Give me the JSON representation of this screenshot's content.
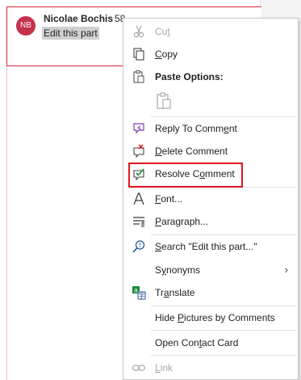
{
  "comment": {
    "avatar_initials": "NB",
    "author": "Nicolae Bochis",
    "time": "58",
    "text": "Edit this part"
  },
  "menu": {
    "cut": {
      "pre": "Cu",
      "u": "t",
      "post": ""
    },
    "copy": {
      "pre": "",
      "u": "C",
      "post": "opy"
    },
    "paste_options": "Paste Options:",
    "reply": {
      "pre": "Reply To Comm",
      "u": "e",
      "post": "nt"
    },
    "delete": {
      "pre": "",
      "u": "D",
      "post": "elete Comment"
    },
    "resolve": {
      "pre": "Resolve C",
      "u": "o",
      "post": "mment"
    },
    "font": {
      "pre": "",
      "u": "F",
      "post": "ont..."
    },
    "paragraph": {
      "pre": "",
      "u": "P",
      "post": "aragraph..."
    },
    "search": {
      "pre": "",
      "u": "S",
      "post": "earch \"Edit this part...\""
    },
    "synonyms": {
      "pre": "S",
      "u": "y",
      "post": "nonyms"
    },
    "translate": {
      "pre": "Tr",
      "u": "a",
      "post": "nslate"
    },
    "hide_pictures": {
      "pre": "Hide ",
      "u": "P",
      "post": "ictures by Comments"
    },
    "open_contact": {
      "pre": "Open Con",
      "u": "t",
      "post": "act Card"
    },
    "link": {
      "pre": "",
      "u": "L",
      "post": "ink"
    },
    "submenu_chevron": "›"
  },
  "icons": {
    "cut": "scissors-icon",
    "copy": "copy-icon",
    "paste": "clipboard-icon",
    "reply": "reply-comment-icon",
    "delete": "delete-comment-icon",
    "resolve": "resolve-comment-icon",
    "font": "font-icon",
    "paragraph": "paragraph-icon",
    "search": "search-icon",
    "translate": "translate-icon",
    "link": "link-icon"
  },
  "colors": {
    "accent_red": "#e0141e",
    "card_border": "#d9263a",
    "avatar_bg": "#c4314b",
    "icon_blue": "#2b579a",
    "icon_green": "#1e8c3a",
    "icon_purple": "#7b3fb8"
  }
}
